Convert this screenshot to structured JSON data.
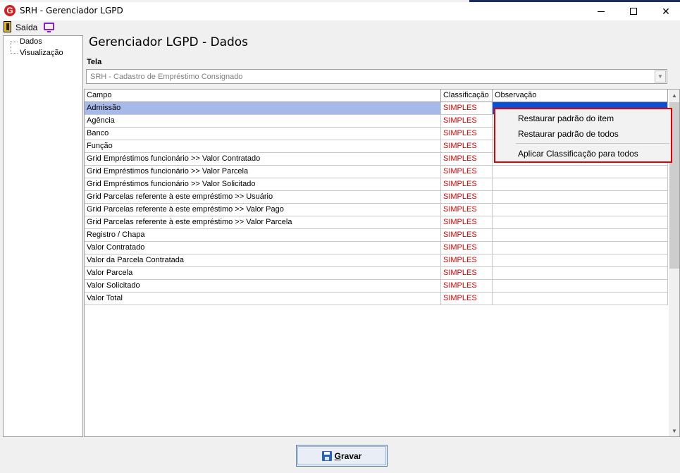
{
  "window": {
    "title": "SRH - Gerenciador LGPD",
    "app_icon_letter": "G"
  },
  "toolbar": {
    "exit_label": "Saída"
  },
  "tree": {
    "items": [
      {
        "label": "Dados"
      },
      {
        "label": "Visualização"
      }
    ]
  },
  "main": {
    "heading": "Gerenciador LGPD - Dados",
    "tela_label": "Tela",
    "tela_value": "SRH - Cadastro de Empréstimo Consignado"
  },
  "grid": {
    "columns": [
      "Campo",
      "Classificação",
      "Observação"
    ],
    "rows": [
      {
        "campo": "Admissão",
        "classificacao": "SIMPLES",
        "observacao": ""
      },
      {
        "campo": "Agência",
        "classificacao": "SIMPLES",
        "observacao": ""
      },
      {
        "campo": "Banco",
        "classificacao": "SIMPLES",
        "observacao": ""
      },
      {
        "campo": "Função",
        "classificacao": "SIMPLES",
        "observacao": ""
      },
      {
        "campo": "Grid Empréstimos funcionário >> Valor Contratado",
        "classificacao": "SIMPLES",
        "observacao": ""
      },
      {
        "campo": "Grid Empréstimos funcionário >> Valor Parcela",
        "classificacao": "SIMPLES",
        "observacao": ""
      },
      {
        "campo": "Grid Empréstimos funcionário >> Valor Solicitado",
        "classificacao": "SIMPLES",
        "observacao": ""
      },
      {
        "campo": "Grid Parcelas referente à este empréstimo >> Usuário",
        "classificacao": "SIMPLES",
        "observacao": ""
      },
      {
        "campo": "Grid Parcelas referente à este empréstimo >> Valor Pago",
        "classificacao": "SIMPLES",
        "observacao": ""
      },
      {
        "campo": "Grid Parcelas referente à este empréstimo >> Valor Parcela",
        "classificacao": "SIMPLES",
        "observacao": ""
      },
      {
        "campo": "Registro / Chapa",
        "classificacao": "SIMPLES",
        "observacao": ""
      },
      {
        "campo": "Valor Contratado",
        "classificacao": "SIMPLES",
        "observacao": ""
      },
      {
        "campo": "Valor da Parcela Contratada",
        "classificacao": "SIMPLES",
        "observacao": ""
      },
      {
        "campo": "Valor Parcela",
        "classificacao": "SIMPLES",
        "observacao": ""
      },
      {
        "campo": "Valor Solicitado",
        "classificacao": "SIMPLES",
        "observacao": ""
      },
      {
        "campo": "Valor Total",
        "classificacao": "SIMPLES",
        "observacao": ""
      }
    ],
    "selected_row": 0
  },
  "context_menu": {
    "items": [
      {
        "label": "Restaurar padrão do item"
      },
      {
        "label": "Restaurar padrão de todos"
      },
      {
        "label": "Aplicar Classificação para todos"
      }
    ]
  },
  "footer": {
    "save_label_prefix": "G",
    "save_label_rest": "ravar"
  },
  "colors": {
    "classification_text": "#e00000",
    "highlight_border": "#e00000",
    "selection": "#a6b9e9"
  },
  "icons": {
    "app": "srh-logo-icon",
    "exit": "exit-door-icon",
    "monitor": "monitor-icon",
    "save": "floppy-disk-icon"
  }
}
